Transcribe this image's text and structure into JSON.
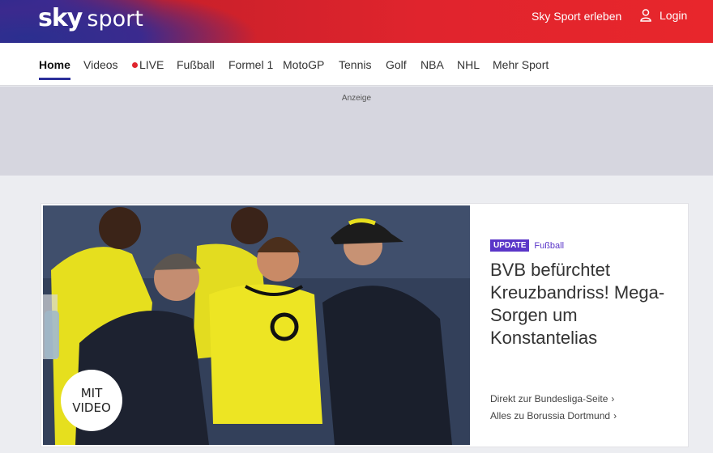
{
  "header": {
    "logo_sky": "sky",
    "logo_sport": "sport",
    "erleben_label": "Sky Sport erleben",
    "login_label": "Login",
    "login_icon": "user-icon"
  },
  "nav": {
    "items": [
      {
        "label": "Home"
      },
      {
        "label": "Videos"
      },
      {
        "label": "LIVE"
      },
      {
        "label": "Fußball"
      },
      {
        "label": "Formel 1"
      },
      {
        "label": "MotoGP"
      },
      {
        "label": "Tennis"
      },
      {
        "label": "Golf"
      },
      {
        "label": "NBA"
      },
      {
        "label": "NHL"
      },
      {
        "label": "Mehr Sport"
      }
    ],
    "active": "Home"
  },
  "ad": {
    "label": "Anzeige"
  },
  "article": {
    "badge": "UPDATE",
    "category": "Fußball",
    "headline": "BVB befürchtet Kreuzbandriss! Mega-Sorgen um Konstantelias",
    "video_badge_line1": "MIT",
    "video_badge_line2": "VIDEO",
    "links": [
      {
        "label": "Direkt zur Bundesliga-Seite"
      },
      {
        "label": "Alles zu Borussia Dortmund"
      }
    ]
  },
  "colors": {
    "brand_blue": "#2c2f9a",
    "brand_red": "#e0242d",
    "accent_purple": "#5a35c8"
  }
}
